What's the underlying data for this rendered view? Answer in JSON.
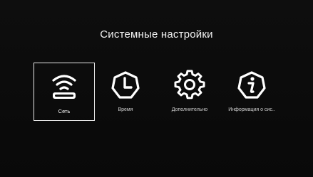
{
  "screen": {
    "title": "Системные настройки",
    "accent_color": "#ffffff",
    "background_color": "#0b0b0b"
  },
  "menu": {
    "items": [
      {
        "label": "Сеть",
        "icon": "wifi-router-icon",
        "focused": true
      },
      {
        "label": "Время",
        "icon": "clock-icon",
        "focused": false
      },
      {
        "label": "Дополнительно",
        "icon": "gear-icon",
        "focused": false
      },
      {
        "label": "Информация о сис..",
        "icon": "info-icon",
        "focused": false
      }
    ]
  }
}
